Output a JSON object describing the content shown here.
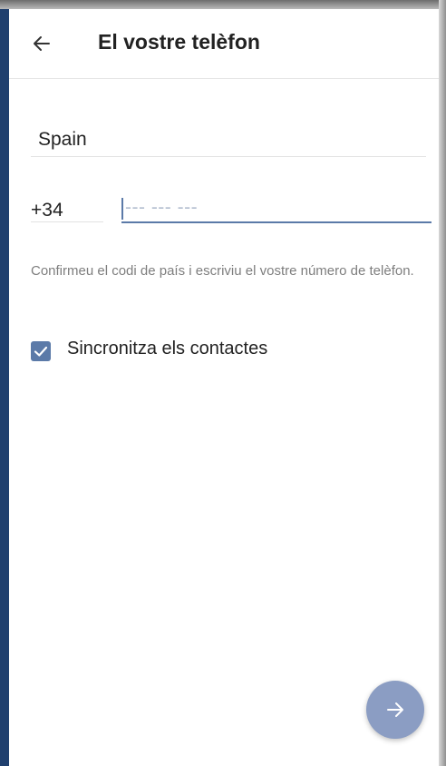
{
  "header": {
    "title": "El vostre telèfon",
    "back_icon": "arrow-left-icon"
  },
  "form": {
    "country": "Spain",
    "country_code": "+34",
    "phone_placeholder": "--- --- ---",
    "hint": "Confirmeu el codi de país i escriviu el vostre número de telèfon."
  },
  "sync": {
    "label": "Sincronitza els contactes",
    "checked": true
  },
  "fab": {
    "icon": "arrow-right-icon"
  },
  "colors": {
    "accent": "#5b7aa8",
    "fab": "#8b9dc3",
    "text": "#222222",
    "hint": "#7e7e7e"
  }
}
